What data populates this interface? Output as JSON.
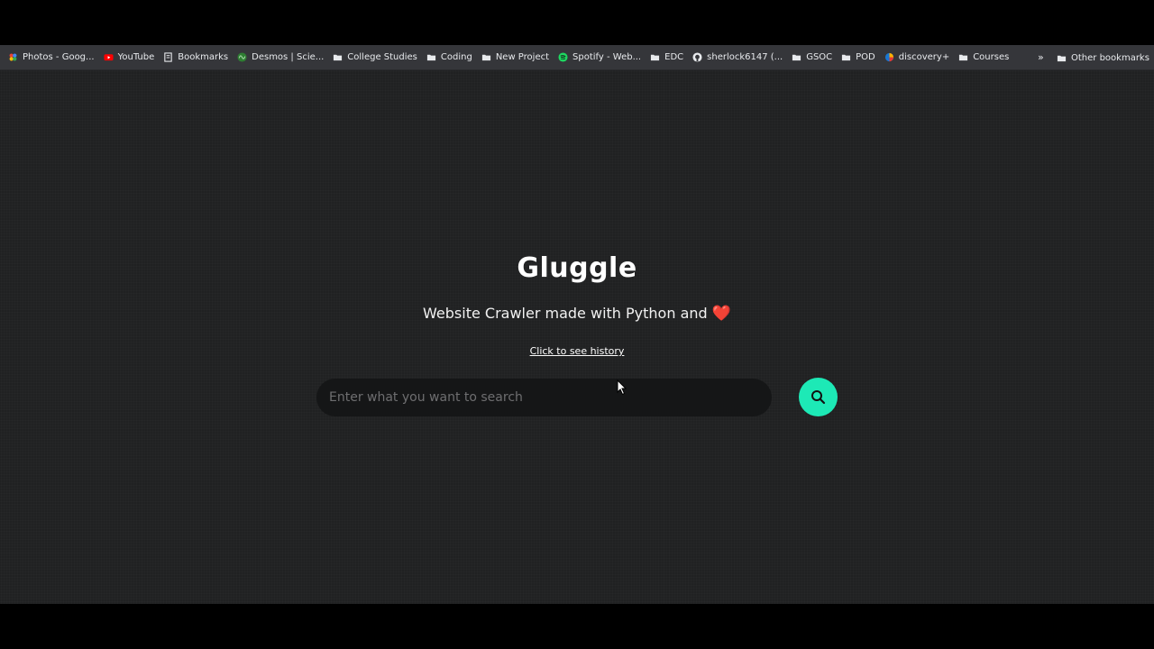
{
  "bookmarks_bar": {
    "items": [
      {
        "label": "Photos - Goog...",
        "icon": "google-photos-icon"
      },
      {
        "label": "YouTube",
        "icon": "youtube-icon"
      },
      {
        "label": "Bookmarks",
        "icon": "bookmarks-icon"
      },
      {
        "label": "Desmos | Scie...",
        "icon": "desmos-icon"
      },
      {
        "label": "College Studies",
        "icon": "folder-icon"
      },
      {
        "label": "Coding",
        "icon": "folder-icon"
      },
      {
        "label": "New Project",
        "icon": "folder-icon"
      },
      {
        "label": "Spotify - Web...",
        "icon": "spotify-icon"
      },
      {
        "label": "EDC",
        "icon": "folder-icon"
      },
      {
        "label": "sherlock6147 (...",
        "icon": "github-icon"
      },
      {
        "label": "GSOC",
        "icon": "folder-icon"
      },
      {
        "label": "POD",
        "icon": "folder-icon"
      },
      {
        "label": "discovery+",
        "icon": "discovery-icon"
      },
      {
        "label": "Courses",
        "icon": "folder-icon"
      }
    ],
    "overflow_label": "»",
    "other_bookmarks": {
      "label": "Other bookmarks",
      "icon": "folder-icon"
    }
  },
  "page": {
    "title": "Gluggle",
    "subtitle": "Website Crawler made with Python and",
    "subtitle_emoji": "❤️",
    "history_link": "Click to see history",
    "search": {
      "placeholder": "Enter what you want to search",
      "value": "",
      "button_icon": "search-icon"
    }
  },
  "colors": {
    "background": "#202122",
    "accent": "#1de9b6",
    "input_bg": "#151617",
    "bookmarks_bar": "#35363a"
  }
}
